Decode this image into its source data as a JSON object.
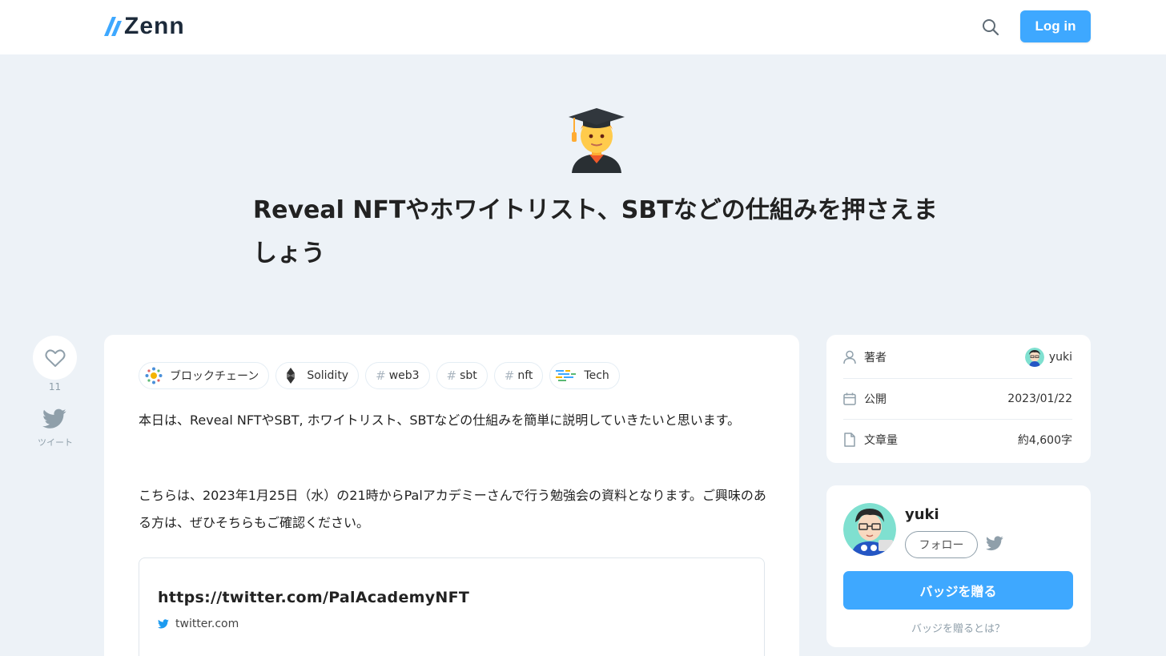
{
  "header": {
    "logo_text": "Zenn",
    "login_label": "Log in",
    "search_icon": "search-icon"
  },
  "article": {
    "emoji": "student-emoji",
    "title": "Reveal NFTやホワイトリスト、SBTなどの仕組みを押さえましょう",
    "tags": [
      {
        "label": "ブロックチェーン",
        "icon": "blockchain-icon"
      },
      {
        "label": "Solidity",
        "icon": "solidity-icon"
      },
      {
        "label": "web3",
        "icon": "hash"
      },
      {
        "label": "sbt",
        "icon": "hash"
      },
      {
        "label": "nft",
        "icon": "hash"
      },
      {
        "label": "Tech",
        "icon": "tech-icon"
      }
    ],
    "paragraph1": "本日は、Reveal NFTやSBT, ホワイトリスト、SBTなどの仕組みを簡単に説明していきたいと思います。",
    "paragraph2": "こちらは、2023年1月25日（水）の21時からPalアカデミーさんで行う勉強会の資料となります。ご興味のある方は、ぜひそちらもご確認ください。",
    "linkcard": {
      "title": "https://twitter.com/PalAcademyNFT",
      "domain": "twitter.com"
    }
  },
  "share": {
    "like_count": "11",
    "tweet_label": "ツイート"
  },
  "meta": {
    "author_label": "著者",
    "author_value": "yuki",
    "published_label": "公開",
    "published_value": "2023/01/22",
    "length_label": "文章量",
    "length_value": "約4,600字"
  },
  "author_card": {
    "name": "yuki",
    "follow_label": "フォロー",
    "badge_label": "バッジを贈る",
    "badge_help": "バッジを贈るとは？"
  },
  "colors": {
    "accent": "#3ea8ff",
    "background": "#edf2f7"
  }
}
